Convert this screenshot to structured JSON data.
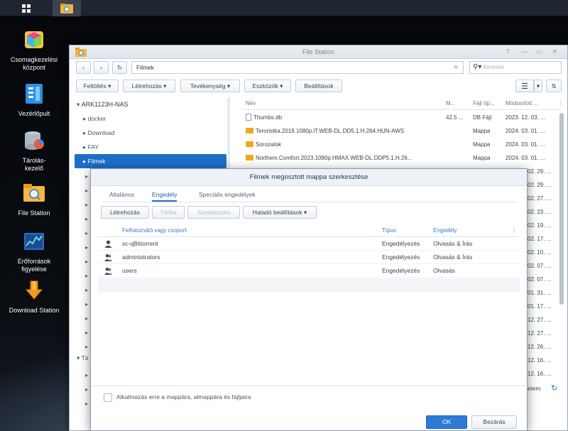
{
  "desktop": {
    "icons": [
      {
        "label": "Csomagkezelési központ"
      },
      {
        "label": "Vezérlőpult"
      },
      {
        "label": "Tárolás-kezelő"
      },
      {
        "label": "File Station"
      },
      {
        "label": "Erőforrások figyelése"
      },
      {
        "label": "Download Station"
      }
    ]
  },
  "filestation": {
    "title": "File Station",
    "path": "Filmek",
    "search_placeholder": "Keresés",
    "toolbar": {
      "upload": "Feltöltés",
      "create": "Létrehozás",
      "action": "Tevékenység",
      "tools": "Eszközök",
      "settings": "Beállítások"
    },
    "tree": {
      "root": "ARK1123H-NAS",
      "items": [
        "docker",
        "Download",
        "FAY",
        "Filmek"
      ],
      "partial_label": "Tá"
    },
    "columns": {
      "name": "Név",
      "size": "M...",
      "type": "Fájl típ...",
      "modified": "Módosított ..."
    },
    "files": [
      {
        "name": "Thumbs.db",
        "size": "42.5 ...",
        "type": "DB Fájl",
        "modified": "2023. 12. 03. ...",
        "kind": "file"
      },
      {
        "name": "Teroristka.2019.1080p.iT.WEB-DL.DD5.1.H.264.HUN-AWS",
        "size": "",
        "type": "Mappa",
        "modified": "2024. 03. 01. ...",
        "kind": "folder"
      },
      {
        "name": "Sorozatok",
        "size": "",
        "type": "Mappa",
        "modified": "2024. 03. 01. ...",
        "kind": "folder"
      },
      {
        "name": "Northem.Comfort.2023.1080p.HMAX.WEB-DL.DDP5.1.H.26...",
        "size": "",
        "type": "Mappa",
        "modified": "2024. 03. 01. ...",
        "kind": "folder"
      }
    ],
    "hidden_dates": [
      "02. 29. ...",
      "02. 29. ...",
      "02. 27. ...",
      "02. 23. ...",
      "02. 19. ...",
      "02. 17. ...",
      "02. 10. ...",
      "02. 07. ...",
      "02. 07. ...",
      "01. 31. ...",
      "01. 17. ...",
      "12. 27. ...",
      "12. 27. ...",
      "12. 26. ...",
      "12. 16. ...",
      "12. 16. ..."
    ],
    "footer_partial": "elem"
  },
  "dialog": {
    "title": "Filmek megosztott mappa szerkesztése",
    "tabs": [
      "Általános",
      "Engedély",
      "Speciális engedélyek"
    ],
    "active_tab": "Engedély",
    "buttons": {
      "create": "Létrehozás",
      "delete": "Törlés",
      "edit": "Szerkesztés",
      "advanced": "Haladó beállítások"
    },
    "columns": {
      "user": "Felhasználó vagy csoport",
      "type": "Típus",
      "permission": "Engedély"
    },
    "rows": [
      {
        "user": "sc-qBittorrent",
        "type": "Engedélyezés",
        "permission": "Olvasás & Írás",
        "kind": "user"
      },
      {
        "user": "administrators",
        "type": "Engedélyezés",
        "permission": "Olvasás & Írás",
        "kind": "group"
      },
      {
        "user": "users",
        "type": "Engedélyezés",
        "permission": "Olvasás",
        "kind": "group"
      }
    ],
    "apply_label": "Alkalmazás erre a mappára, almappára és fájljaira",
    "ok": "OK",
    "cancel": "Bezárás"
  }
}
